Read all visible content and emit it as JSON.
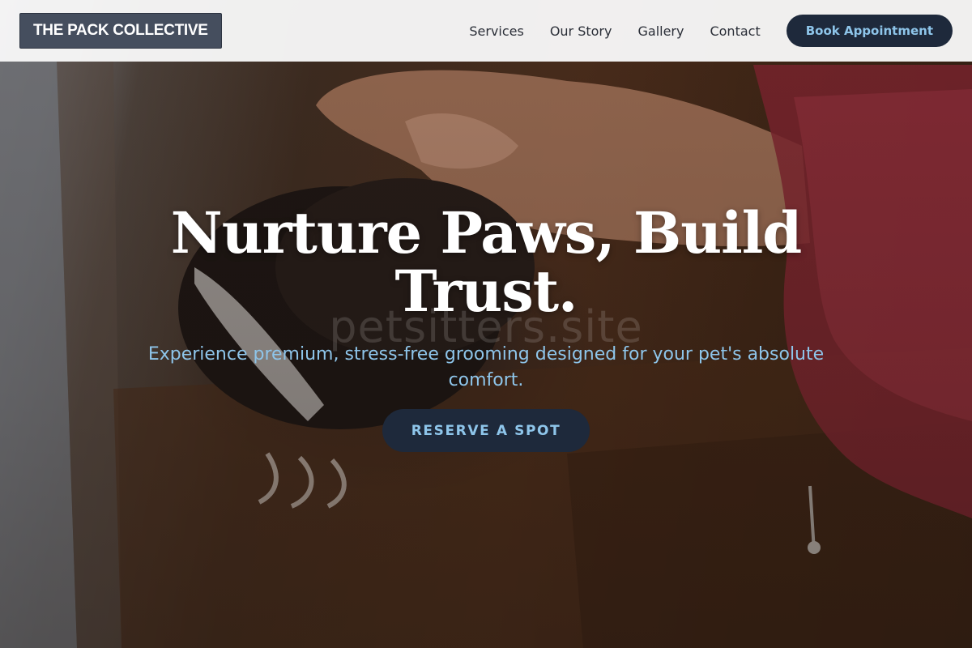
{
  "header": {
    "logo_text": "THE PACK COLLECTIVE",
    "nav": [
      "Services",
      "Our Story",
      "Gallery",
      "Contact"
    ],
    "cta_label": "Book Appointment"
  },
  "hero": {
    "title": "Nurture Paws, Build Trust.",
    "watermark": "petsitters.site",
    "subtitle": "Experience premium, stress-free grooming designed for your pet's absolute comfort.",
    "cta_label": "RESERVE A SPOT",
    "image_alt": "skunk-being-petted-photo"
  },
  "colors": {
    "header_bg": "#f8f8f8",
    "logo_bg": "#454e5e",
    "button_bg": "#1e293b",
    "accent_text": "#8ec5ea",
    "title_text": "#ffffff"
  }
}
